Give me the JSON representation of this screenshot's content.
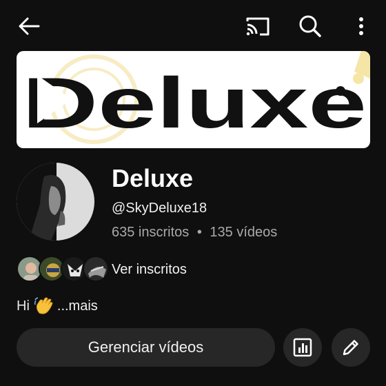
{
  "header": {
    "back_icon": "arrow-left-icon",
    "cast_icon": "cast-icon",
    "search_icon": "search-icon",
    "more_icon": "more-vertical-icon"
  },
  "banner": {
    "text": "Deluxe"
  },
  "channel": {
    "name": "Deluxe",
    "handle": "@SkyDeluxe18",
    "subscribers": "635 inscritos",
    "separator": "•",
    "videos": "135 vídeos"
  },
  "subscribers_preview": {
    "label": "Ver inscritos",
    "avatars": [
      "subscriber-avatar-1",
      "subscriber-avatar-2",
      "subscriber-avatar-3",
      "subscriber-avatar-4"
    ]
  },
  "about": {
    "text": "Hi",
    "emoji": "waving-hand-icon",
    "more": "...mais"
  },
  "actions": {
    "manage_videos": "Gerenciar vídeos",
    "analytics_icon": "analytics-icon",
    "edit_icon": "pencil-icon"
  },
  "colors": {
    "background": "#0f0f0f",
    "button": "#272727",
    "secondary_text": "#aaaaaa",
    "banner_background": "#ffffff",
    "banner_accent": "#f5e6a8"
  }
}
